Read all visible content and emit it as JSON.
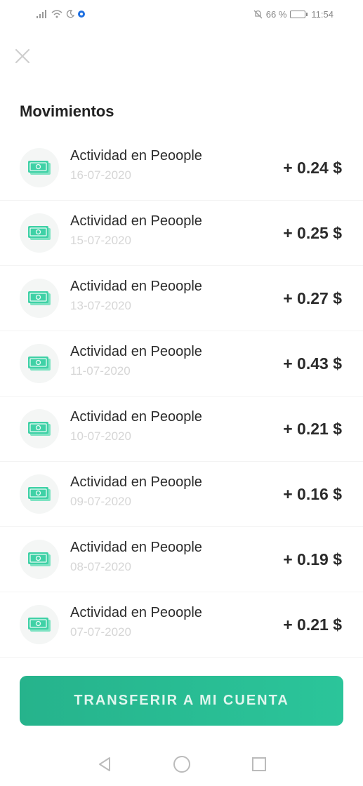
{
  "status_bar": {
    "battery_percent": "66 %",
    "battery_level": 0.66,
    "time": "11:54",
    "icons": [
      "signal-icon",
      "wifi-icon",
      "moon-icon",
      "app-notification-icon",
      "do-not-disturb-icon",
      "battery-icon"
    ]
  },
  "header": {
    "close_icon": "close-icon"
  },
  "section_title": "Movimientos",
  "movements": [
    {
      "title": "Actividad en Peoople",
      "date": "16-07-2020",
      "amount": "+ 0.24 $"
    },
    {
      "title": "Actividad en Peoople",
      "date": "15-07-2020",
      "amount": "+ 0.25 $"
    },
    {
      "title": "Actividad en Peoople",
      "date": "13-07-2020",
      "amount": "+ 0.27 $"
    },
    {
      "title": "Actividad en Peoople",
      "date": "11-07-2020",
      "amount": "+ 0.43 $"
    },
    {
      "title": "Actividad en Peoople",
      "date": "10-07-2020",
      "amount": "+ 0.21 $"
    },
    {
      "title": "Actividad en Peoople",
      "date": "09-07-2020",
      "amount": "+ 0.16 $"
    },
    {
      "title": "Actividad en Peoople",
      "date": "08-07-2020",
      "amount": "+ 0.19 $"
    },
    {
      "title": "Actividad en Peoople",
      "date": "07-07-2020",
      "amount": "+ 0.21 $"
    }
  ],
  "cta": {
    "label": "TRANSFERIR A MI CUENTA"
  },
  "colors": {
    "accent": "#26b38c",
    "money_icon": "#3fd1a6",
    "date_text": "#d6d6d6"
  },
  "nav": {
    "icons": [
      "back-icon",
      "home-icon",
      "recents-icon"
    ]
  }
}
